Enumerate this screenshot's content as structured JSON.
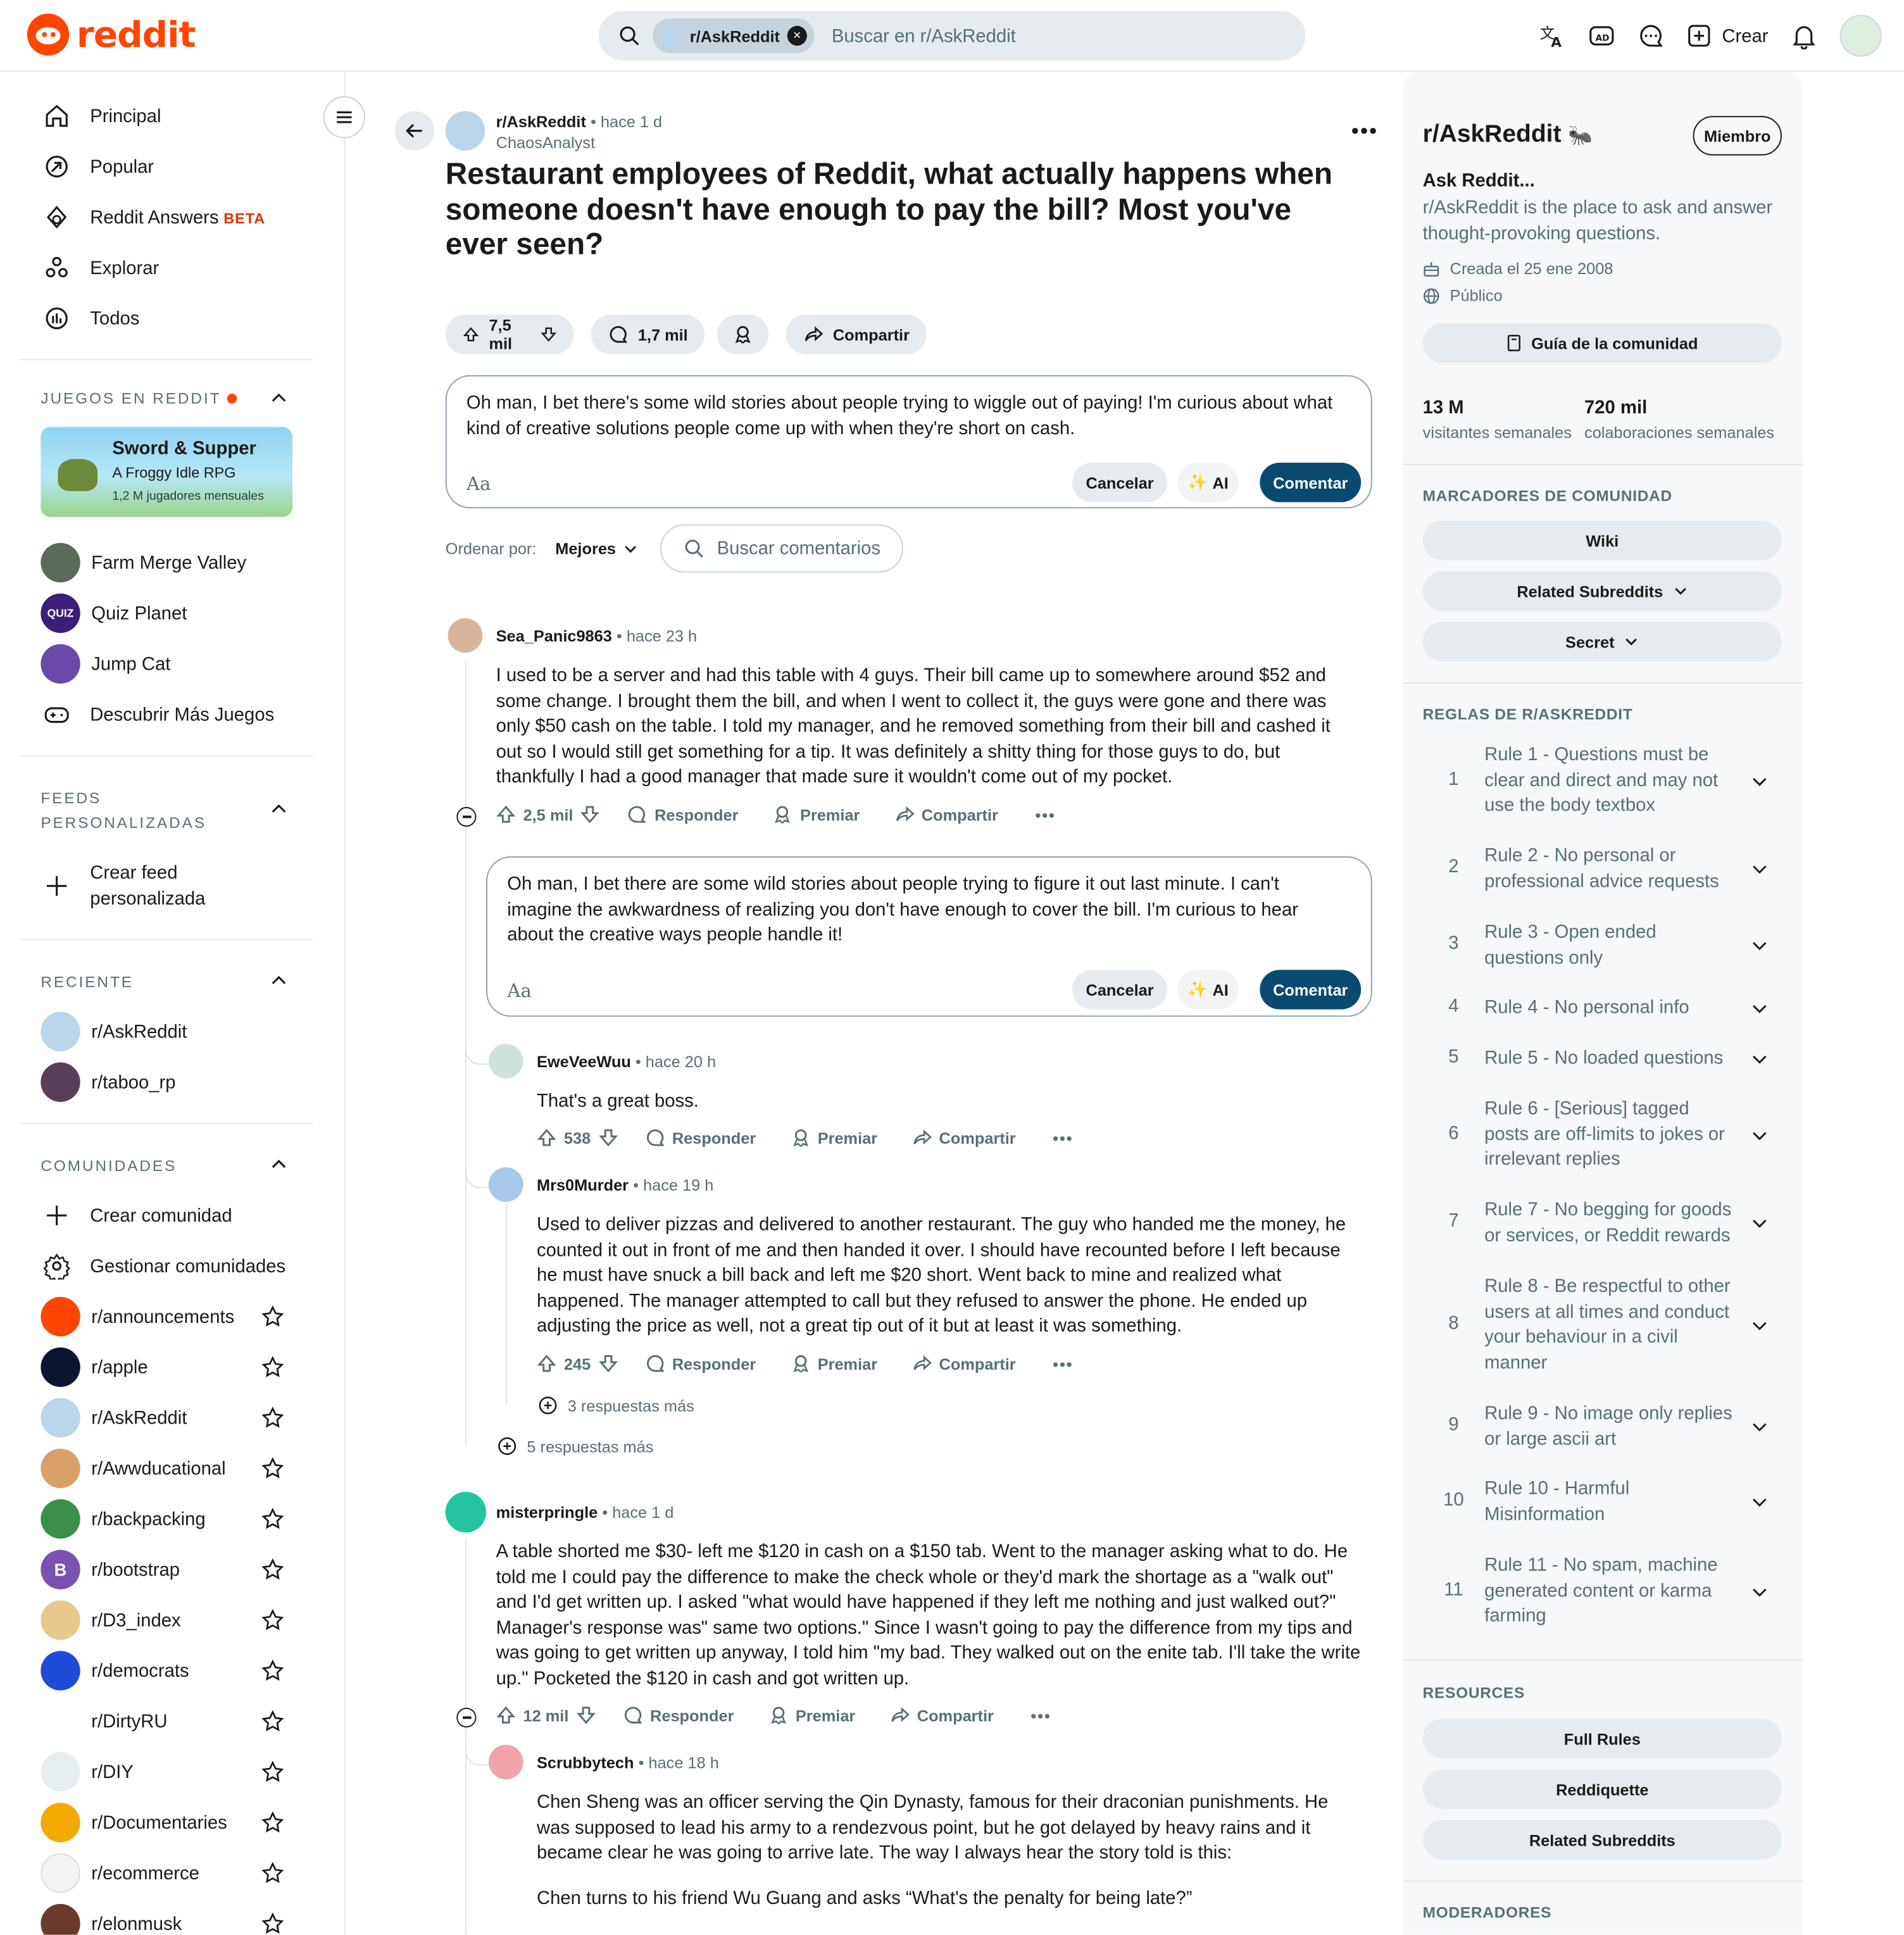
{
  "header": {
    "logo_text": "reddit",
    "search_chip": "r/AskReddit",
    "search_placeholder": "Buscar en r/AskReddit",
    "create_label": "Crear"
  },
  "left_nav": {
    "items": [
      "Principal",
      "Popular",
      "Reddit Answers",
      "Explorar",
      "Todos"
    ],
    "beta": "BETA",
    "games_title": "JUEGOS EN REDDIT",
    "game_card": {
      "title": "Sword & Supper",
      "subtitle": "A Froggy Idle RPG",
      "players": "1,2 M jugadores mensuales"
    },
    "games": [
      "Farm Merge Valley",
      "Quiz Planet",
      "Jump Cat",
      "Descubrir Más Juegos"
    ],
    "feeds_title_1": "FEEDS",
    "feeds_title_2": "PERSONALIZADAS",
    "create_feed_1": "Crear feed",
    "create_feed_2": "personalizada",
    "recent_title": "RECIENTE",
    "recent": [
      "r/AskReddit",
      "r/taboo_rp"
    ],
    "communities_title": "COMUNIDADES",
    "create_community": "Crear comunidad",
    "manage_communities": "Gestionar comunidades",
    "communities": [
      "r/announcements",
      "r/apple",
      "r/AskReddit",
      "r/Awwducational",
      "r/backpacking",
      "r/bootstrap",
      "r/D3_index",
      "r/democrats",
      "r/DirtyRU",
      "r/DIY",
      "r/Documentaries",
      "r/ecommerce",
      "r/elonmusk"
    ]
  },
  "post": {
    "subreddit": "r/AskReddit",
    "time": "• hace 1 d",
    "author": "ChaosAnalyst",
    "title": "Restaurant employees of Reddit, what actually happens when someone doesn't have enough to pay the bill? Most you've ever seen?",
    "votes": "7,5 mil",
    "comments": "1,7 mil",
    "share": "Compartir"
  },
  "editor1": {
    "text": "Oh man, I bet there's some wild stories about people trying to wiggle out of paying! I'm curious about what kind of creative solutions people come up with when they're short on cash.",
    "aa": "Aa",
    "cancel": "Cancelar",
    "ai": "AI",
    "submit": "Comentar"
  },
  "sort": {
    "label": "Ordenar por:",
    "value": "Mejores",
    "search_placeholder": "Buscar comentarios"
  },
  "comments": {
    "c1": {
      "user": "Sea_Panic9863",
      "time": "• hace 23 h",
      "body": "I used to be a server and had this table with 4 guys. Their bill came up to somewhere around $52 and some change. I brought them the bill, and when I went to collect it, the guys were gone and there was only $50 cash on the table. I told my manager, and he removed something from their bill and cashed it out so I would still get something for a tip. It was definitely a shitty thing for those guys to do, but thankfully I had a good manager that made sure it wouldn't come out of my pocket.",
      "votes": "2,5 mil"
    },
    "editor2": {
      "text": "Oh man, I bet there are some wild stories about people trying to figure it out last minute. I can't imagine the awkwardness of realizing you don't have enough to cover the bill. I'm curious to hear about the creative ways people handle it!"
    },
    "c2": {
      "user": "EweVeeWuu",
      "time": "• hace 20 h",
      "body": "That's a great boss.",
      "votes": "538"
    },
    "c3": {
      "user": "Mrs0Murder",
      "time": "• hace 19 h",
      "body": "Used to deliver pizzas and delivered to another restaurant. The guy who handed me the money, he counted it out in front of me and then handed it over. I should have recounted before I left because he must have snuck a bill back and left me $20 short. Went back to mine and realized what happened. The manager attempted to call but they refused to answer the phone. He ended up adjusting the price as well, not a great tip out of it but at least it was something.",
      "votes": "245"
    },
    "more3": "3 respuestas más",
    "more5": "5 respuestas más",
    "c4": {
      "user": "misterpringle",
      "time": "• hace 1 d",
      "body": "A table shorted me $30- left me $120 in cash on a $150 tab. Went to the manager asking what to do. He told me I could pay the difference to make the check whole or they'd mark the shortage as a \"walk out\" and I'd get written up. I asked \"what would have happened if they left me nothing and just walked out?\" Manager's response was\" same two options.\" Since I wasn't going to pay the difference from my tips and was going to get written up anyway, I told him \"my bad. They walked out on the enite tab. I'll take the write up.\" Pocketed the $120 in cash and got written up.",
      "votes": "12 mil"
    },
    "c5": {
      "user": "Scrubbytech",
      "time": "• hace 18 h",
      "body": "Chen Sheng was an officer serving the Qin Dynasty, famous for their draconian punishments. He was supposed to lead his army to a rendezvous point, but he got delayed by heavy rains and it became clear he was going to arrive late. The way I always hear the story told is this:",
      "body2": "Chen turns to his friend Wu Guang and asks “What's the penalty for being late?”"
    },
    "actions": {
      "reply": "Responder",
      "award": "Premiar",
      "share": "Compartir"
    }
  },
  "right": {
    "name": "r/AskReddit",
    "join": "Miembro",
    "headline": "Ask Reddit...",
    "desc": "r/AskReddit is the place to ask and answer thought-provoking questions.",
    "created": "Creada el 25 ene 2008",
    "visibility": "Público",
    "guide": "Guía de la comunidad",
    "stat1_value": "13 M",
    "stat1_label": "visitantes semanales",
    "stat2_value": "720 mil",
    "stat2_label": "colaboraciones semanales",
    "bookmarks_title": "MARCADORES DE COMUNIDAD",
    "bookmarks": [
      "Wiki",
      "Related Subreddits",
      "Secret"
    ],
    "rules_title": "REGLAS DE R/ASKREDDIT",
    "rules": [
      "Rule 1 - Questions must be clear and direct and may not use the body textbox",
      "Rule 2 - No personal or professional advice requests",
      "Rule 3 - Open ended questions only",
      "Rule 4 - No personal info",
      "Rule 5 - No loaded questions",
      "Rule 6 - [Serious] tagged posts are off-limits to jokes or irrelevant replies",
      "Rule 7 - No begging for goods or services, or Reddit rewards",
      "Rule 8 - Be respectful to other users at all times and conduct your behaviour in a civil manner",
      "Rule 9 - No image only replies or large ascii art",
      "Rule 10 - Harmful Misinformation",
      "Rule 11 - No spam, machine generated content or karma farming"
    ],
    "rule_numbers": [
      "1",
      "2",
      "3",
      "4",
      "5",
      "6",
      "7",
      "8",
      "9",
      "10",
      "11"
    ],
    "resources_title": "RESOURCES",
    "resources": [
      "Full Rules",
      "Reddiquette",
      "Related Subreddits"
    ],
    "moderators_title": "MODERADORES"
  },
  "colors": {
    "brand": "#ff4500",
    "primary_button": "#0a4a6e",
    "beta": "#d93900"
  }
}
